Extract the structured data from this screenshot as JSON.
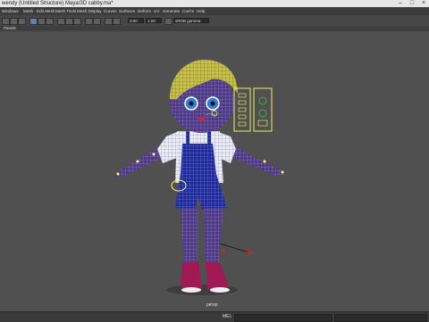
{
  "window": {
    "title": "wendy (Untitled Structure) Maya/3D cabby.ma*"
  },
  "menubar": {
    "items": [
      "Windows",
      "Mesh",
      "Edit Mesh",
      "Mesh Tools",
      "Mesh Display",
      "Curves",
      "Surfaces",
      "Deform",
      "UV",
      "Generate",
      "Cache",
      "Help"
    ]
  },
  "toolbar": {
    "field_1": "0.00",
    "field_2": "1.00",
    "colorspace": "sRGB gamma"
  },
  "panels_menu": {
    "label": "Panels"
  },
  "viewport": {
    "camera": "persp"
  },
  "statusbar": {
    "mel_label": "MEL"
  },
  "colors": {
    "mesh_wire": "#2d2fae",
    "hair": "#d8cd58",
    "skin_wire": "#8a4a7a",
    "selection_yellow": "#ffff66",
    "control_green": "#44cc44",
    "control_red": "#dd2222"
  }
}
